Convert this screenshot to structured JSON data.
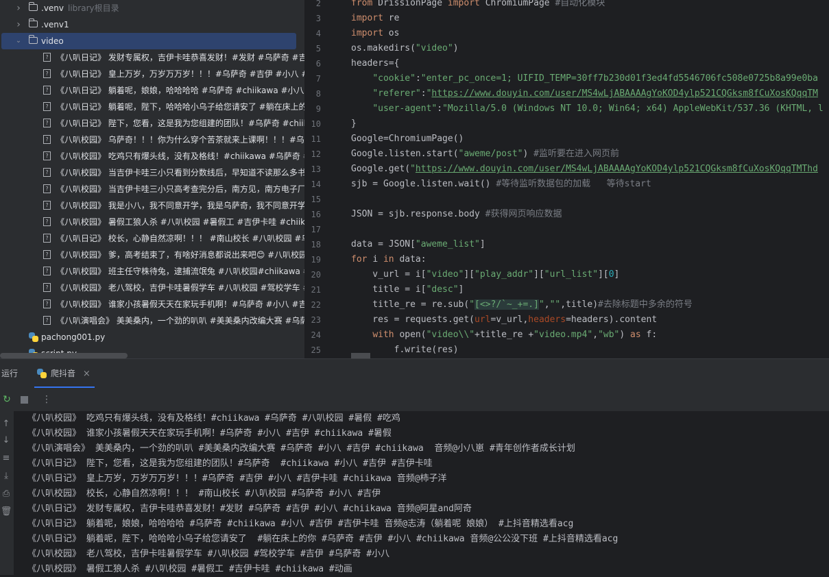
{
  "project_tree": {
    "items": [
      {
        "type": "folder",
        "label": ".venv",
        "hint": "library根目录",
        "expanded": false
      },
      {
        "type": "folder",
        "label": ".venv1",
        "hint": "",
        "expanded": false
      },
      {
        "type": "folder",
        "label": "video",
        "hint": "",
        "expanded": true,
        "selected": true
      },
      {
        "type": "file",
        "label": "《八叭日记》 发财专属权，吉伊卡哇恭喜发财！#发财 #乌萨奇 #吉伊"
      },
      {
        "type": "file",
        "label": "《八叭日记》 皇上万岁，万岁万万岁！！！#乌萨奇 #吉伊 #小八 #吉"
      },
      {
        "type": "file",
        "label": "《八叭日记》 躺着呢，娘娘，哈哈哈哈 #乌萨奇 #chiikawa #小八 #吉伊"
      },
      {
        "type": "file",
        "label": "《八叭日记》 躺着呢，陛下，哈哈哈小乌子给您请安了  #躺在床上的你"
      },
      {
        "type": "file",
        "label": "《八叭日记》 陛下，您看，这是我为您组建的团队！#乌萨奇  #chiikawa"
      },
      {
        "type": "file",
        "label": "《八叭校园》 乌萨奇！！！你为什么穿个苦茶就来上课啊！！！#乌萨奇"
      },
      {
        "type": "file",
        "label": "《八叭校园》 吃鸡只有爆头线，没有及格线！#chiikawa #乌萨奇 #八叭"
      },
      {
        "type": "file",
        "label": "《八叭校园》 当吉伊卡哇三小只看到分数线后，早知道不读那么多书了"
      },
      {
        "type": "file",
        "label": "《八叭校园》 当吉伊卡哇三小只高考查完分后，南方见，南方电子厂见"
      },
      {
        "type": "file",
        "label": "《八叭校园》 我是小八，我不同意开学，我是乌萨奇，我不同意开学"
      },
      {
        "type": "file",
        "label": "《八叭校园》 暑假工狼人杀 #八叭校园 #暑假工 #吉伊卡哇 #chiikawa"
      },
      {
        "type": "file",
        "label": "《八叭日记》 校长，心静自然凉啊！！！ #南山校长 #八叭校园 #乌萨奇"
      },
      {
        "type": "file",
        "label": "《八叭校园》 爹，高考结束了，有啥好消息都说出来吧😊 #八叭校园"
      },
      {
        "type": "file",
        "label": "《八叭校园》 班主任守株待兔，逮捕流氓兔 #八叭校园#chiikawa #小八"
      },
      {
        "type": "file",
        "label": "《八叭校园》 老八驾校，吉伊卡哇暑假学车 #八叭校园 #驾校学车 #吉伊"
      },
      {
        "type": "file",
        "label": "《八叭校园》 谁家小孩暑假天天在家玩手机啊！#乌萨奇 #小八 #吉伊"
      },
      {
        "type": "file",
        "label": "《八叭演唱会》 美美桑内，一个劲的叭叭 #美美桑内改编大赛 #乌萨奇"
      },
      {
        "type": "py",
        "label": "pachong001.py"
      },
      {
        "type": "py",
        "label": "script.py"
      }
    ]
  },
  "editor": {
    "lines": [
      {
        "n": "2",
        "segs": [
          [
            "kw",
            "from "
          ],
          [
            "",
            "DrissionPage "
          ],
          [
            "kw",
            "import "
          ],
          [
            "",
            "ChromiumPage "
          ],
          [
            "cm",
            "#自动化模块"
          ]
        ]
      },
      {
        "n": "3",
        "segs": [
          [
            "kw",
            "import "
          ],
          [
            "",
            "re"
          ]
        ]
      },
      {
        "n": "4",
        "segs": [
          [
            "kw",
            "import "
          ],
          [
            "",
            "os"
          ]
        ]
      },
      {
        "n": "5",
        "segs": [
          [
            "",
            "os.makedirs("
          ],
          [
            "str",
            "\"video\""
          ],
          [
            "",
            ")"
          ]
        ]
      },
      {
        "n": "6",
        "segs": [
          [
            "",
            "headers={"
          ]
        ]
      },
      {
        "n": "7",
        "segs": [
          [
            "",
            "    "
          ],
          [
            "str",
            "\"cookie\""
          ],
          [
            "",
            ":"
          ],
          [
            "str",
            "\"enter_pc_once=1; UIFID_TEMP=30ff7b230d01f3ed4fd5546706fc508e0725b8a99e0ba"
          ]
        ]
      },
      {
        "n": "8",
        "segs": [
          [
            "",
            "    "
          ],
          [
            "str",
            "\"referer\""
          ],
          [
            "",
            ":"
          ],
          [
            "str",
            "\""
          ],
          [
            "url",
            "https://www.douyin.com/user/MS4wLjABAAAAgYoKOD4ylp521CQGksm8fCuXosKQqqTM"
          ]
        ]
      },
      {
        "n": "9",
        "segs": [
          [
            "",
            "    "
          ],
          [
            "str",
            "\"user-agent\""
          ],
          [
            "",
            ":"
          ],
          [
            "str",
            "\"Mozilla/5.0 (Windows NT 10.0; Win64; x64) AppleWebKit/537.36 (KHTML, l"
          ]
        ]
      },
      {
        "n": "10",
        "segs": [
          [
            "",
            "}"
          ]
        ]
      },
      {
        "n": "11",
        "segs": [
          [
            "",
            "Google=ChromiumPage()"
          ]
        ]
      },
      {
        "n": "12",
        "segs": [
          [
            "",
            "Google.listen.start("
          ],
          [
            "str",
            "\"aweme/post\""
          ],
          [
            "",
            ") "
          ],
          [
            "cm",
            "#监听要在进入网页前"
          ]
        ]
      },
      {
        "n": "13",
        "segs": [
          [
            "",
            "Google.get("
          ],
          [
            "str",
            "\""
          ],
          [
            "url",
            "https://www.douyin.com/user/MS4wLjABAAAAgYoKOD4ylp521CQGksm8fCuXosKQqqTMThd"
          ]
        ]
      },
      {
        "n": "14",
        "segs": [
          [
            "",
            "sjb = Google.listen.wait() "
          ],
          [
            "cm",
            "#等待监听数据包的加载   等待start"
          ]
        ]
      },
      {
        "n": "15",
        "segs": []
      },
      {
        "n": "16",
        "segs": [
          [
            "",
            "JSON = sjb.response.body "
          ],
          [
            "cm",
            "#获得网页响应数据"
          ]
        ]
      },
      {
        "n": "17",
        "segs": []
      },
      {
        "n": "18",
        "segs": [
          [
            "",
            "data = JSON["
          ],
          [
            "str",
            "\"aweme_list\""
          ],
          [
            "",
            "]"
          ]
        ]
      },
      {
        "n": "19",
        "segs": [
          [
            "kw",
            "for "
          ],
          [
            "",
            "i "
          ],
          [
            "kw",
            "in "
          ],
          [
            "",
            "data:"
          ]
        ]
      },
      {
        "n": "20",
        "segs": [
          [
            "",
            "    v_url = i["
          ],
          [
            "str",
            "\"video\""
          ],
          [
            "",
            "]["
          ],
          [
            "str",
            "\"play_addr\""
          ],
          [
            "",
            "]["
          ],
          [
            "str",
            "\"url_list\""
          ],
          [
            "",
            "]["
          ],
          [
            "num",
            "0"
          ],
          [
            "",
            "]"
          ]
        ]
      },
      {
        "n": "21",
        "segs": [
          [
            "",
            "    title = i["
          ],
          [
            "str",
            "\"desc\""
          ],
          [
            "",
            "]"
          ]
        ]
      },
      {
        "n": "22",
        "segs": [
          [
            "",
            "    title_re = re.sub("
          ],
          [
            "str",
            "\""
          ],
          [
            "strhl",
            "[<>?/`~_+=.]"
          ],
          [
            "str",
            "\""
          ],
          [
            "",
            ","
          ],
          [
            "str",
            "\"\""
          ],
          [
            "",
            ",title)"
          ],
          [
            "cm",
            "#去除标题中多余的符号"
          ]
        ]
      },
      {
        "n": "23",
        "segs": [
          [
            "",
            "    res = requests.get("
          ],
          [
            "kwarg",
            "url"
          ],
          [
            "",
            "=v_url,"
          ],
          [
            "kwarg",
            "headers"
          ],
          [
            "",
            "=headers).content"
          ]
        ]
      },
      {
        "n": "24",
        "segs": [
          [
            "",
            "    "
          ],
          [
            "kw",
            "with "
          ],
          [
            "",
            "open("
          ],
          [
            "str",
            "\"video\\\\\""
          ],
          [
            "",
            "+title_re +"
          ],
          [
            "str",
            "\"video.mp4\""
          ],
          [
            "",
            ","
          ],
          [
            "str",
            "\"wb\""
          ],
          [
            "",
            ") "
          ],
          [
            "kw",
            "as "
          ],
          [
            "",
            "f:"
          ]
        ]
      },
      {
        "n": "25",
        "segs": [
          [
            "",
            "        f.write(res)"
          ]
        ]
      }
    ]
  },
  "run_panel": {
    "label": "运行",
    "tab_title": "爬抖音",
    "close": "×",
    "icons": {
      "rerun": "rerun-icon",
      "stop": "stop-icon",
      "more": "more-icon",
      "up": "scroll-up-icon",
      "down": "scroll-down-icon",
      "wrap": "soft-wrap-icon",
      "scroll_end": "scroll-to-end-icon",
      "print": "print-icon",
      "clear": "clear-icon"
    },
    "output": [
      "《八叭校园》 吃鸡只有爆头线，没有及格线！#chiikawa #乌萨奇 #八叭校园 #暑假 #吃鸡",
      "《八叭校园》 谁家小孩暑假天天在家玩手机啊！#乌萨奇 #小八 #吉伊 #chiikawa #暑假",
      "《八叭演唱会》 美美桑内，一个劲的叭叭 #美美桑内改编大赛 #乌萨奇 #小八 #吉伊 #chiikawa  音频@小八崽 #青年创作者成长计划",
      "《八叭日记》 陛下，您看，这是我为您组建的团队！#乌萨奇  #chiikawa #小八 #吉伊 #吉伊卡哇",
      "《八叭日记》 皇上万岁，万岁万万岁！！！#乌萨奇 #吉伊 #小八 #吉伊卡哇 #chiikawa 音频@柿子洋",
      "《八叭校园》 校长，心静自然凉啊！！！ #南山校长 #八叭校园 #乌萨奇 #小八 #吉伊",
      "《八叭日记》 发财专属权，吉伊卡哇恭喜发财！#发财 #乌萨奇 #吉伊 #小八 #chiikawa 音频@阿星and阿奇",
      "《八叭日记》 躺着呢，娘娘，哈哈哈哈 #乌萨奇 #chiikawa #小八 #吉伊 #吉伊卡哇 音频@志涛（躺着呢 娘娘） #上抖音精选看acg",
      "《八叭日记》 躺着呢，陛下，哈哈哈小乌子给您请安了  #躺在床上的你 #乌萨奇 #吉伊 #小八 #chiikawa 音频@公公没下班 #上抖音精选看acg",
      "《八叭校园》 老八驾校，吉伊卡哇暑假学车 #八叭校园 #驾校学车 #吉伊 #乌萨奇 #小八",
      "《八叭校园》 暑假工狼人杀 #八叭校园 #暑假工 #吉伊卡哇 #chiikawa #动画"
    ]
  }
}
